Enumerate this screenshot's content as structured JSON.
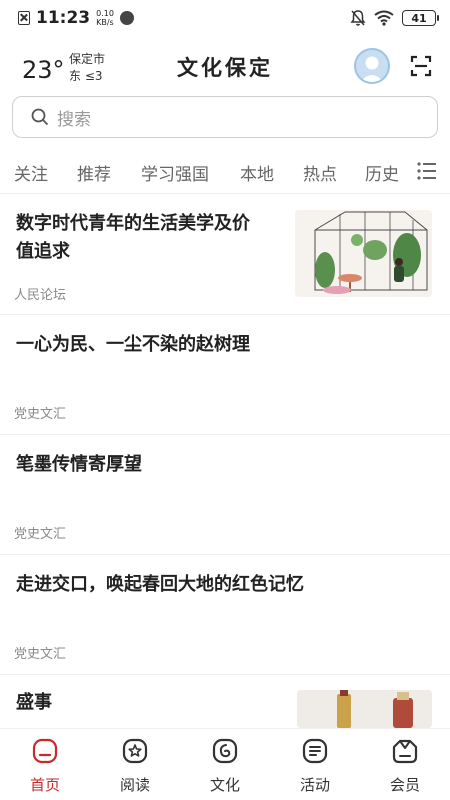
{
  "status_bar": {
    "time": "11:23",
    "speed_value": "0.10",
    "speed_unit": "KB/s",
    "battery": "41"
  },
  "header": {
    "temperature": "23°",
    "city": "保定市",
    "wind": "东  ≤3",
    "app_title": "文化保定"
  },
  "search": {
    "placeholder": "搜索"
  },
  "tabs": [
    "关注",
    "推荐",
    "学习强国",
    "本地",
    "热点",
    "历史"
  ],
  "feed": [
    {
      "title_line1": "数字时代青年的生活美学及价",
      "title_line2": "值追求",
      "source": "人民论坛"
    },
    {
      "title_line1": "一心为民、一尘不染的赵树理",
      "source": "党史文汇"
    },
    {
      "title_line1": "笔墨传情寄厚望",
      "source": "党史文汇"
    },
    {
      "title_line1": "走进交口，唤起春回大地的红色记忆",
      "source": "党史文汇"
    },
    {
      "title_line1": "盛事"
    }
  ],
  "bottom_nav": [
    {
      "label": "首页",
      "icon": "home-icon",
      "active": true
    },
    {
      "label": "阅读",
      "icon": "read-icon"
    },
    {
      "label": "文化",
      "icon": "culture-icon"
    },
    {
      "label": "活动",
      "icon": "activity-icon"
    },
    {
      "label": "会员",
      "icon": "member-icon"
    }
  ],
  "colors": {
    "accent": "#c62a2a",
    "text": "#222222",
    "muted": "#8a8a8a"
  }
}
